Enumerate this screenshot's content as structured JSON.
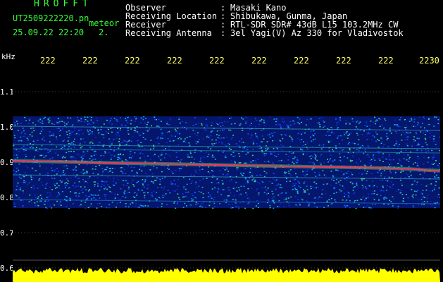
{
  "header": {
    "title": "HROFFT",
    "filename": "UT2509222220.pn",
    "meteor_label": "meteor",
    "date_time": "25.09.22 22:20",
    "count": "2.",
    "fields": [
      {
        "label": "Observer",
        "value": "Masaki Kano"
      },
      {
        "label": "Receiving Location",
        "value": "Shibukawa, Gunma, Japan"
      },
      {
        "label": "Receiver",
        "value": "RTL-SDR SDR# 43dB L15 103.2MHz CW"
      },
      {
        "label": "Receiving Antenna",
        "value": "3el Yagi(V) Az 330 for Vladivostok"
      }
    ]
  },
  "axes": {
    "y_unit": "kHz",
    "y_ticks": [
      "1.1",
      "1.0",
      "0.9",
      "0.8",
      "0.7",
      "0.6"
    ],
    "x_ticks": [
      "222",
      "222",
      "222",
      "222",
      "222",
      "222",
      "222",
      "222",
      "222",
      "2230"
    ]
  },
  "colors": {
    "text_green": "#33ff33",
    "text_white": "#ffffff",
    "tick_yellow": "#ffff66",
    "trace_red": "#ff3060",
    "noise_blue": "#0a2cc8",
    "level_yellow": "#ffff00"
  }
}
